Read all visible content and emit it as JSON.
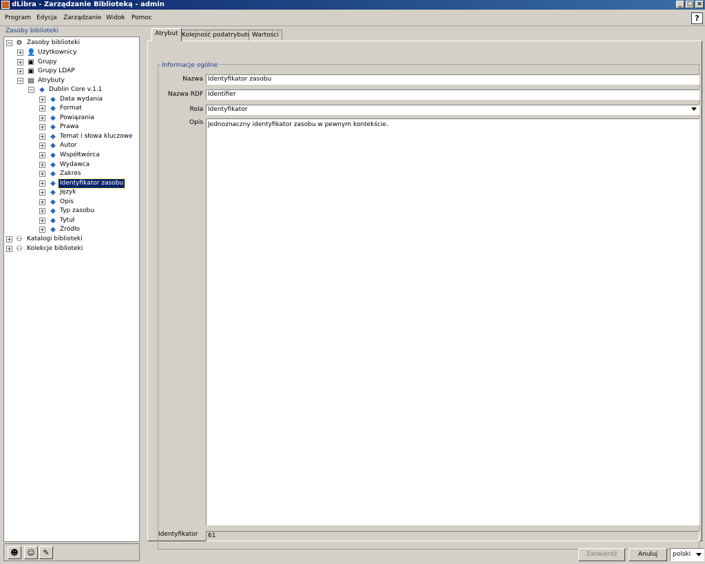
{
  "window": {
    "title": "dLibra - Zarządzanie Biblioteką - admin"
  },
  "menu": [
    "Program",
    "Edycja",
    "Zarządzanie",
    "Widok",
    "Pomoc"
  ],
  "left": {
    "legend": "Zasoby biblioteki",
    "tree": {
      "root": "Zasoby biblioteki",
      "level1": [
        "Użytkownicy",
        "Grupy",
        "Grupy LDAP",
        "Atrybuty"
      ],
      "schema": "Dublin Core v.1.1",
      "attributes": [
        "Data wydania",
        "Format",
        "Powiązania",
        "Prawa",
        "Temat i słowa kluczowe",
        "Autor",
        "Współtwórca",
        "Wydawca",
        "Zakres",
        "Identyfikator zasobu",
        "Język",
        "Opis",
        "Typ zasobu",
        "Tytuł",
        "Źródło"
      ],
      "catalogs": "Katalogi biblioteki",
      "collections": "Kolekcje biblioteki"
    }
  },
  "tabs": [
    "Atrybut",
    "Kolejność podatrybutów",
    "Wartości"
  ],
  "form": {
    "group_legend": "Informacje ogólne",
    "name_label": "Nazwa",
    "name_value": "Identyfikator zasobu",
    "rdf_label": "Nazwa RDF",
    "rdf_value": "Identifier",
    "role_label": "Rola",
    "role_value": "Identyfikator",
    "desc_label": "Opis",
    "desc_value": "Jednoznaczny identyfikator zasobu w pewnym kontekście.",
    "id_label": "Identyfikator",
    "id_value": "61"
  },
  "buttons": {
    "confirm": "Zatwierdź",
    "cancel": "Anuluj"
  },
  "language": "polski"
}
